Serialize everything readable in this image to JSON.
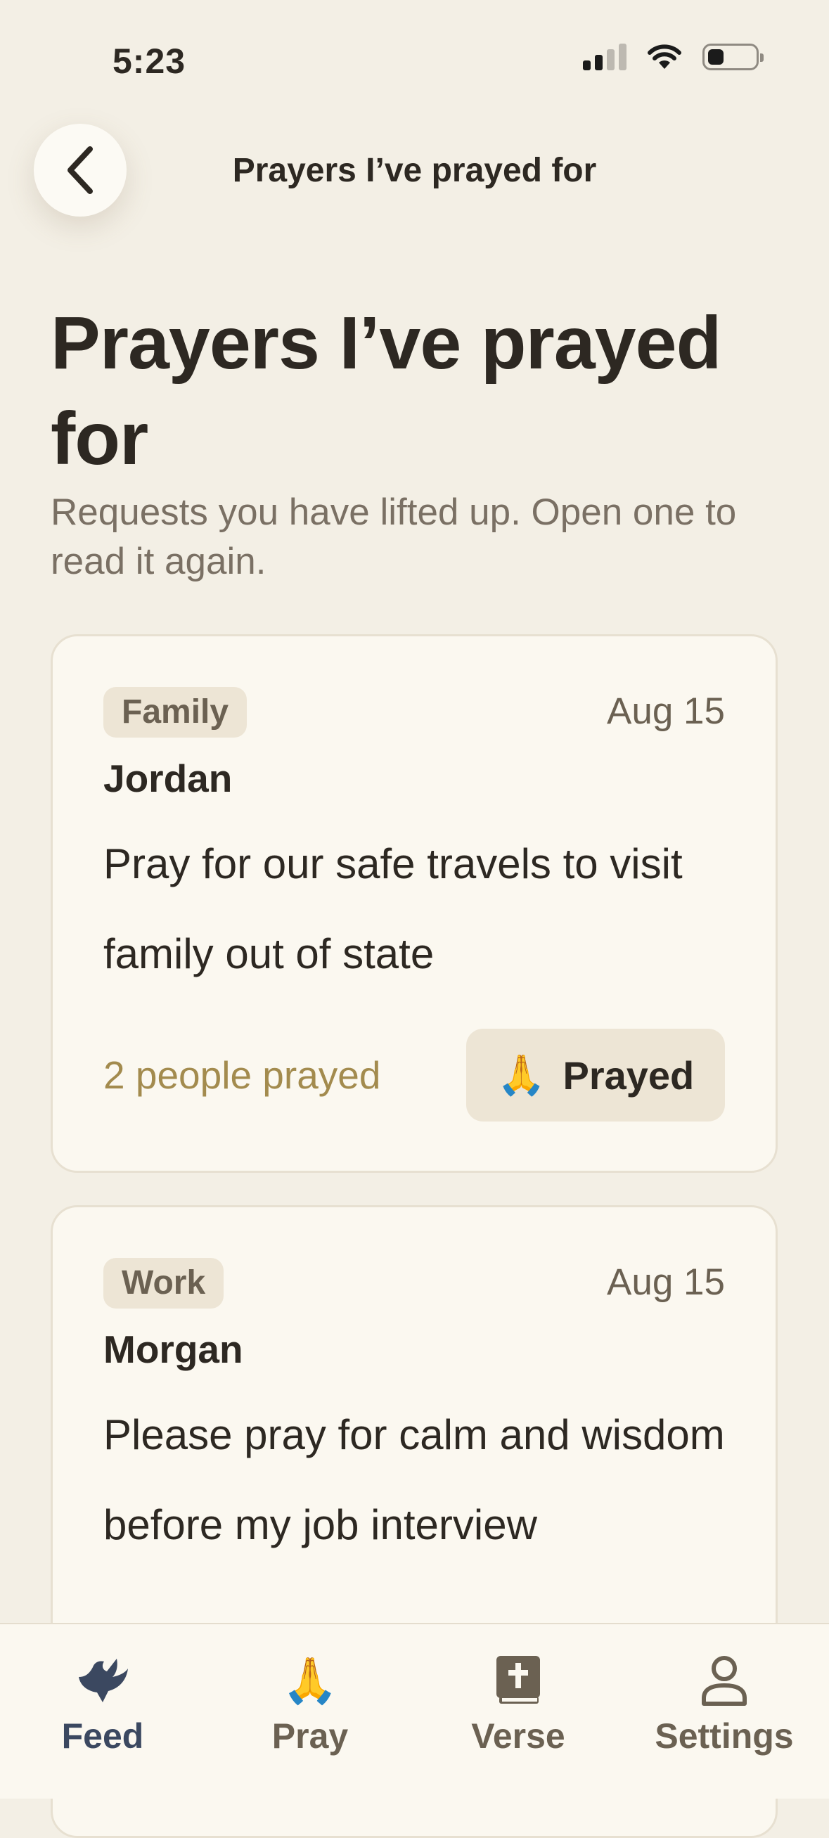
{
  "status_bar": {
    "time": "5:23"
  },
  "nav": {
    "title": "Prayers I’ve prayed for"
  },
  "header": {
    "title": "Prayers I’ve prayed for",
    "subtitle": "Requests you have lifted up. Open one to read it again."
  },
  "cards": [
    {
      "tag": "Family",
      "date": "Aug 15",
      "name": "Jordan",
      "text": "Pray for our safe travels to visit family out of state",
      "count": "2 people prayed",
      "button_label": "Prayed",
      "button_icon": "🙏"
    },
    {
      "tag": "Work",
      "date": "Aug 15",
      "name": "Morgan",
      "text": "Please pray for calm and wisdom before my job interview"
    }
  ],
  "tabs": [
    {
      "label": "Feed",
      "icon": "dove-icon",
      "active": true
    },
    {
      "label": "Pray",
      "icon": "🙏"
    },
    {
      "label": "Verse",
      "icon": "bible-icon"
    },
    {
      "label": "Settings",
      "icon": "person-icon"
    }
  ],
  "colors": {
    "background": "#f3efe5",
    "card": "#fbf8f0",
    "accent": "#a38b4e",
    "active_tab": "#3b4860",
    "tag_bg": "#ede5d5"
  }
}
